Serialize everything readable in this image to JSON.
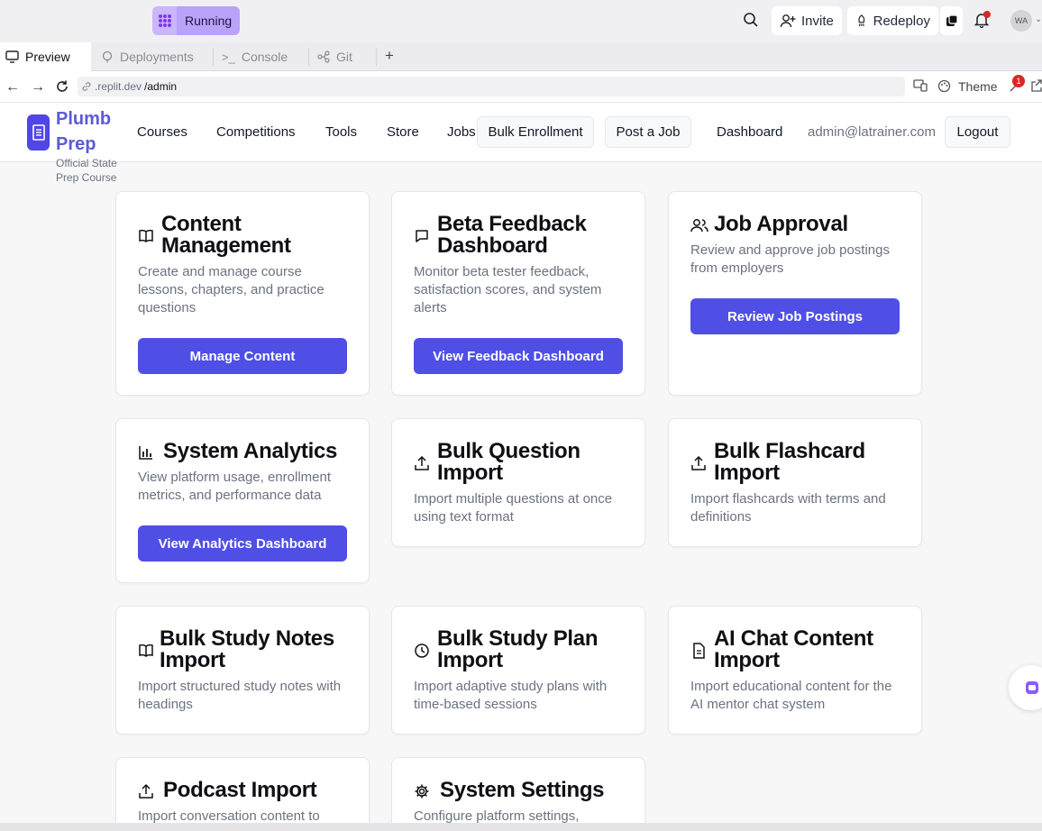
{
  "topbar": {
    "run_status": "Running",
    "invite_label": "Invite",
    "redeploy_label": "Redeploy",
    "avatar_initials": "WA",
    "icons": [
      "grid-icon",
      "search-icon",
      "add-user-icon",
      "rocket-icon",
      "copy-icon",
      "bell-icon",
      "chevron-down-icon"
    ]
  },
  "tabs": [
    {
      "label": "Preview",
      "active": true
    },
    {
      "label": "Deployments",
      "active": false
    },
    {
      "label": "Console",
      "active": false
    },
    {
      "label": "Git",
      "active": false
    }
  ],
  "address": {
    "domain": ".replit.dev",
    "path": "/admin",
    "theme_label": "Theme",
    "notif_count": "1"
  },
  "header": {
    "brand_line1": "Plumb",
    "brand_line2": "Prep",
    "tagline": "Official State Prep Course",
    "nav": [
      "Courses",
      "Competitions",
      "Tools",
      "Store",
      "Jobs"
    ],
    "bulk_enrollment_label": "Bulk Enrollment",
    "post_job_label": "Post a Job",
    "dashboard_label": "Dashboard",
    "email": "admin@latrainer.com",
    "logout_label": "Logout"
  },
  "cards": [
    {
      "title": "Content Management",
      "desc": "Create and manage course lessons, chapters, and practice questions",
      "button": "Manage Content",
      "icon": "book-icon"
    },
    {
      "title": "Beta Feedback Dashboard",
      "desc": "Monitor beta tester feedback, satisfaction scores, and system alerts",
      "button": "View Feedback Dashboard",
      "icon": "message-icon"
    },
    {
      "title": "Job Approval",
      "desc": "Review and approve job postings from employers",
      "button": "Review Job Postings",
      "icon": "users-icon"
    },
    {
      "title": "System Analytics",
      "desc": "View platform usage, enrollment metrics, and performance data",
      "button": "View Analytics Dashboard",
      "icon": "bar-chart-icon"
    },
    {
      "title": "Bulk Question Import",
      "desc": "Import multiple questions at once using text format",
      "button": "",
      "icon": "upload-icon"
    },
    {
      "title": "Bulk Flashcard Import",
      "desc": "Import flashcards with terms and definitions",
      "button": "",
      "icon": "upload-icon"
    },
    {
      "title": "Bulk Study Notes Import",
      "desc": "Import structured study notes with headings",
      "button": "",
      "icon": "book-icon"
    },
    {
      "title": "Bulk Study Plan Import",
      "desc": "Import adaptive study plans with time-based sessions",
      "button": "",
      "icon": "clock-icon"
    },
    {
      "title": "AI Chat Content Import",
      "desc": "Import educational content for the AI mentor chat system",
      "button": "",
      "icon": "document-icon"
    },
    {
      "title": "Podcast Import",
      "desc": "Import conversation content to",
      "button": "",
      "icon": "upload-icon"
    },
    {
      "title": "System Settings",
      "desc": "Configure platform settings,",
      "button": "",
      "icon": "gear-icon"
    }
  ],
  "colors": {
    "accent": "#4f4fe6",
    "brand": "#5b5bd6",
    "running": "#b9a3fa"
  }
}
